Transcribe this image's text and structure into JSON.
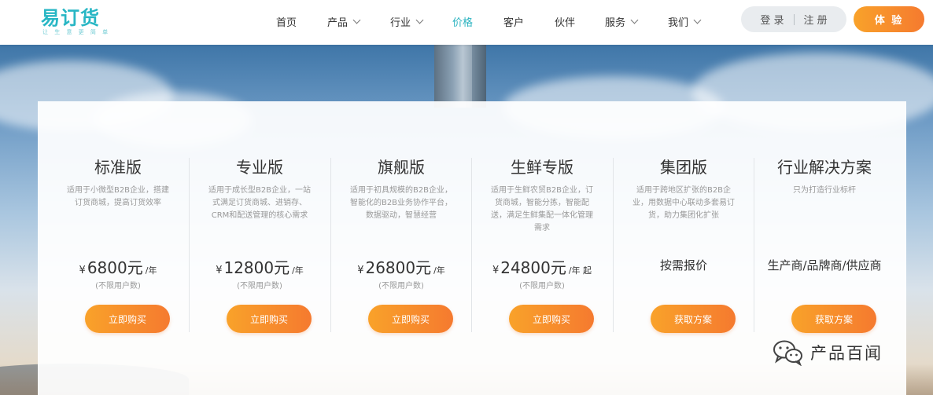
{
  "header": {
    "logo_text": "易订货",
    "logo_sub": "让 生 意 更 简 单",
    "nav": [
      {
        "label": "首页",
        "dropdown": false,
        "active": false
      },
      {
        "label": "产品",
        "dropdown": true,
        "active": false
      },
      {
        "label": "行业",
        "dropdown": true,
        "active": false
      },
      {
        "label": "价格",
        "dropdown": false,
        "active": true
      },
      {
        "label": "客户",
        "dropdown": false,
        "active": false
      },
      {
        "label": "伙伴",
        "dropdown": false,
        "active": false
      },
      {
        "label": "服务",
        "dropdown": true,
        "active": false
      },
      {
        "label": "我们",
        "dropdown": true,
        "active": false
      }
    ],
    "login_label": "登 录",
    "register_label": "注 册",
    "try_label": "体 验"
  },
  "plans": [
    {
      "name": "标准版",
      "desc": "适用于小微型B2B企业，搭建订货商城，提高订货效率",
      "currency": "¥",
      "amount": "6800元",
      "unit": "/年",
      "note": "(不限用户数)",
      "button": "立即购买"
    },
    {
      "name": "专业版",
      "desc": "适用于成长型B2B企业，一站式满足订货商城、进销存、CRM和配送管理的核心需求",
      "currency": "¥",
      "amount": "12800元",
      "unit": "/年",
      "note": "(不限用户数)",
      "button": "立即购买"
    },
    {
      "name": "旗舰版",
      "desc": "适用于初具规模的B2B企业，智能化的B2B业务协作平台，数据驱动，智慧经营",
      "currency": "¥",
      "amount": "26800元",
      "unit": "/年",
      "note": "(不限用户数)",
      "button": "立即购买"
    },
    {
      "name": "生鲜专版",
      "desc": "适用于生鲜农贸B2B企业，订货商城，智能分拣，智能配送，满足生鲜集配一体化管理需求",
      "currency": "¥",
      "amount": "24800元",
      "unit": "/年 起",
      "note": "(不限用户数)",
      "button": "立即购买"
    },
    {
      "name": "集团版",
      "desc": "适用于跨地区扩张的B2B企业，用数据中心联动多套易订货，助力集团化扩张",
      "price_text": "按需报价",
      "button": "获取方案"
    },
    {
      "name": "行业解决方案",
      "desc": "只为打造行业标杆",
      "price_text": "生产商/品牌商/供应商",
      "button": "获取方案"
    }
  ],
  "watermark": {
    "text": "产品百闻",
    "icon": "wechat-icon"
  },
  "colors": {
    "accent_teal": "#2bb3c0",
    "button_orange_start": "#f9a22a",
    "button_orange_end": "#f57a2f"
  }
}
